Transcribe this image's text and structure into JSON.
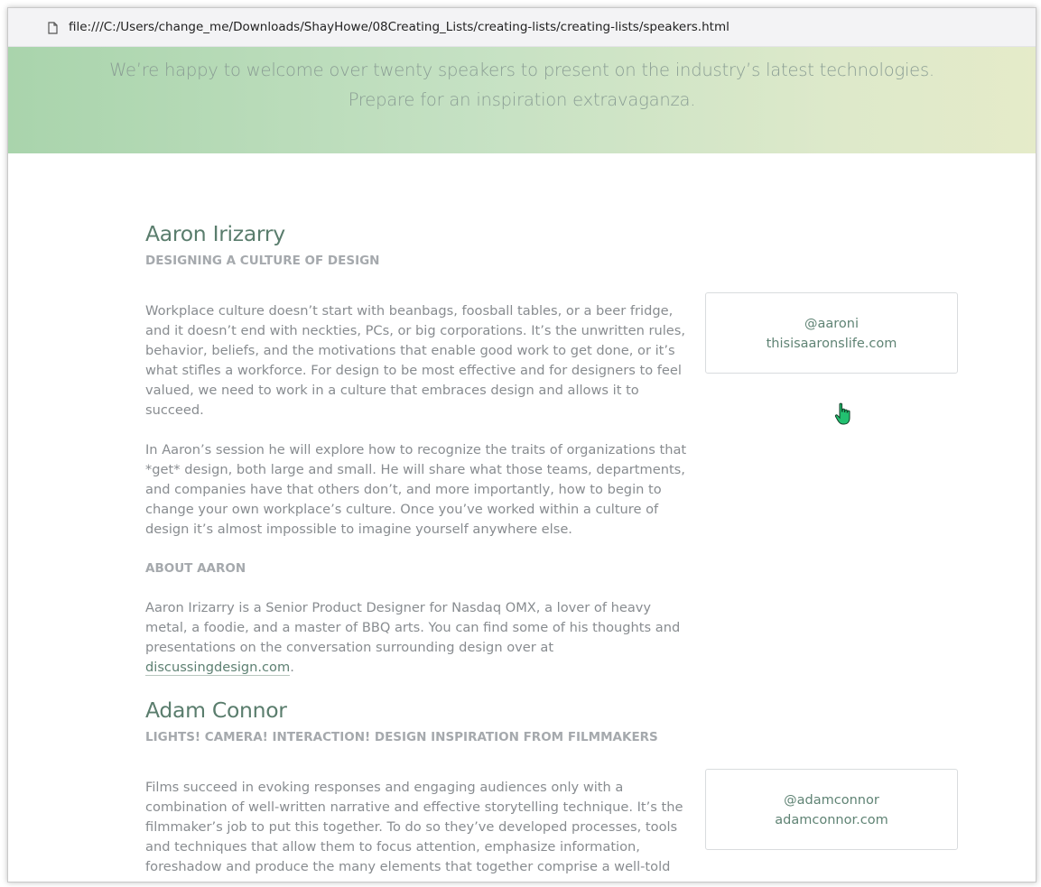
{
  "browser": {
    "url": "file:///C:/Users/change_me/Downloads/ShayHowe/08Creating_Lists/creating-lists/creating-lists/speakers.html"
  },
  "hero": {
    "line1": "We’re happy to welcome over twenty speakers to present on the industry’s latest technologies.",
    "line2": "Prepare for an inspiration extravaganza."
  },
  "speakers": [
    {
      "name": "Aaron Irizarry",
      "session": "DESIGNING A CULTURE OF DESIGN",
      "paragraphs": [
        "Workplace culture doesn’t start with beanbags, foosball tables, or a beer fridge, and it doesn’t end with neckties, PCs, or big corporations. It’s the unwritten rules, behavior, beliefs, and the motivations that enable good work to get done, or it’s what stifles a workforce. For design to be most effective and for designers to feel valued, we need to work in a culture that embraces design and allows it to succeed.",
        "In Aaron’s session he will explore how to recognize the traits of organizations that *get* design, both large and small. He will share what those teams, departments, and companies have that others don’t, and more importantly, how to begin to change your own workplace’s culture. Once you’ve worked within a culture of design it’s almost impossible to imagine yourself anywhere else."
      ],
      "about_heading": "ABOUT AARON",
      "bio_text": "Aaron Irizarry is a Senior Product Designer for Nasdaq OMX, a lover of heavy metal, a foodie, and a master of BBQ arts. You can find some of his thoughts and presentations on the conversation surrounding design over at",
      "bio_link": "discussingdesign.com",
      "bio_end": ".",
      "twitter": "@aaroni",
      "website": "thisisaaronslife.com"
    },
    {
      "name": "Adam Connor",
      "session": "LIGHTS! CAMERA! INTERACTION! DESIGN INSPIRATION FROM FILMMAKERS",
      "paragraphs": [
        "Films succeed in evoking responses and engaging audiences only with a combination of well-written narrative and effective storytelling technique. It’s the filmmaker’s job to put this together. To do so they’ve developed processes, tools and techniques that allow them to focus attention, emphasize information, foreshadow and produce the many elements that together comprise a well-told story."
      ],
      "twitter": "@adamconnor",
      "website": "adamconnor.com"
    }
  ],
  "colors": {
    "hero_gradient_start": "#a9d4ac",
    "hero_gradient_end": "#e5ebc9",
    "heading": "#5a7d6d",
    "body_text": "#888c90",
    "link": "#5d8072",
    "cursor": "#22c070"
  },
  "icons": {
    "address_bar": "document-icon",
    "pointer": "hand-pointer-icon"
  }
}
